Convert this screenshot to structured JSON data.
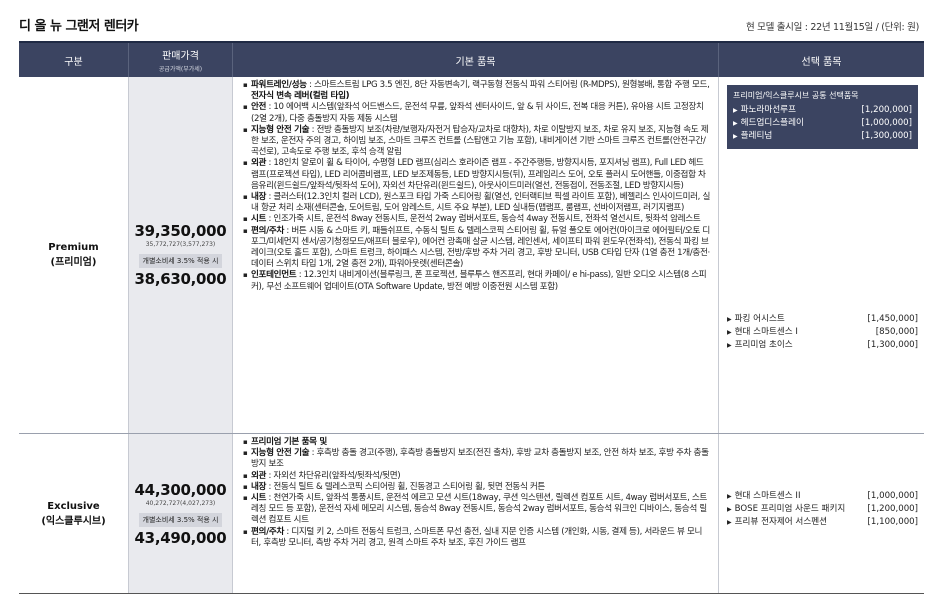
{
  "header": {
    "title": "디 올 뉴 그랜저 렌터카",
    "meta": "현 모델 출시일 : 22년 11월15일 / (단위: 원)"
  },
  "columns": {
    "gubun": "구분",
    "price": "판매가격",
    "price_sub": "공급가액(부가세)",
    "basic": "기본 품목",
    "option": "선택 품목"
  },
  "rows": [
    {
      "name": "Premium",
      "name_ko": "(프리미엄)",
      "price": "39,350,000",
      "price_detail": "35,772,727(3,577,273)",
      "badge": "개별소비세 3.5% 적용 시",
      "price_tax": "38,630,000",
      "basic": [
        "<b>파워트레인/성능</b> : 스마트스트림 LPG 3.5 엔진, 8단 자동변속기, 랙구동형 전동식 파워 스티어링 (R-MDPS), 원형봉배, 통합 주행 모드, <b>전자식 변속 레버(컬럼 타입)</b>",
        "<b>안전</b> : 10 에어백 시스템(앞좌석 어드밴스드, 운전석 무릎, 앞좌석 센터사이드, 앞 &amp; 뒤 사이드, 전복 대응 커튼), 유아용 시트 고정장치(2열 2개), 다중 충돌방지 자동 제동 시스템",
        "<b>지능형 안전 기술</b> : 전방 충돌방지 보조(차량/보행자/자전거 탑승자/교차로 대향차), 차로 이탈방지 보조, 차로 유지 보조, 지능형 속도 제한 보조, 운전자 주의 경고, 하이빔 보조, 스마트 크루즈 컨트롤 (스탑앤고 기능 포함), 내비게이션 기반 스마트 크루즈 컨트롤(안전구간/곡선로), 고속도로 주행 보조, 후석 승객 알림",
        "<b>외관</b> : 18인치 알로이 휠 &amp; 타이어, 수평형 LED 램프(심리스 호라이즌 램프 - 주간주행등, 방향지시등, 포지셔닝 램프), Full LED 헤드램프(프로젝션 타입), LED 리어콤비램프, LED 보조제동등, LED 방향지시등(뒤), 프레임리스 도어, 오토 플러시 도어핸들, 이중접합 차음유리(윈드쉴드/앞좌석/뒷좌석 도어), 자외선 차단유리(윈드쉴드), 아웃사이드미러(열선, 전동접이, 전동조절, LED 방향지시등)",
        "<b>내장</b> : 클러스터(12.3인치 컬러 LCD), 원스포크 타입 가죽 스티어링 휠(열선, 인터랙티브 픽셀 라이트 포함), 베젤리스 인사이드미러, 실내 항균 처리 소재(센터콘솔, 도어트림, 도어 암레스트, 시트 주요 부분), LED 실내등(맵램프, 룸램프, 선바이저램프, 러기지램프)",
        "<b>시트</b> : 인조가죽 시트, 운전석 8way 전동시트, 운전석 2way 럼버서포트, 동승석 4way 전동시트, 전좌석 열선시트, 뒷좌석 암레스트",
        "<b>편의/주차</b> : 버튼 시동 &amp; 스마트 키, 패들쉬프트, 수동식 틸트 &amp; 텔레스코픽 스티어링 휠, 듀얼 풀오토 에어컨(마이크로 에어필터/오토 디포그/미세먼지 센서/공기청정모드/애프터 블로우), 에어컨 광촉매 살균 시스템, 레인센서, 세이프티 파워 윈도우(전좌석), 전동식 파킹 브레이크(오토 홀드 포함), 스마트 트렁크, 하이패스 시스템, 전방/후방 주차 거리 경고, 후방 모니터, USB C타입 단자 (1열 충전 1개/충전·데이터 스위치 타입 1개, 2열 충전 2개), 파워아웃렛(센터콘솔)",
        "<b>인포테인먼트</b> : 12.3인치 내비게이션(블루링크, 폰 프로젝션, 블루투스 핸즈프리, 현대 카페이/ e hi-pass), 일반 오디오 시스템(8 스피커), 무선 소프트웨어 업데이트(OTA Software Update, 방전 예방 이중전원 시스템 포함)"
      ],
      "option_box_title": "프리미엄/익스클루시브 공통 선택품목",
      "option_box": [
        {
          "label": "파노라마선루프",
          "price": "[1,200,000]"
        },
        {
          "label": "헤드업디스플레이",
          "price": "[1,000,000]"
        },
        {
          "label": "플레티넘",
          "price": "[1,300,000]"
        }
      ],
      "options": [
        {
          "label": "파킹 어시스트",
          "price": "[1,450,000]"
        },
        {
          "label": "현대 스마트센스 I",
          "price": "[850,000]"
        },
        {
          "label": "프리미엄 초이스",
          "price": "[1,300,000]"
        }
      ]
    },
    {
      "name": "Exclusive",
      "name_ko": "(익스클루시브)",
      "price": "44,300,000",
      "price_detail": "40,272,727(4,027,273)",
      "badge": "개별소비세 3.5% 적용 시",
      "price_tax": "43,490,000",
      "basic": [
        "<b>프리미엄 기본 품목 및</b>",
        "<b>지능형 안전 기술</b> : 후측방 충돌 경고(주행), 후측방 충돌방지 보조(전진 출차), 후방 교차 충돌방지 보조, 안전 하차 보조, 후방 주차 충돌방지 보조",
        "<b>외관</b> : 자외선 차단유리(앞좌석/뒷좌석/뒷면)",
        "<b>내장</b> : 전동식 틸트 &amp; 텔레스코픽 스티어링 휠, 진동경고 스티어링 휠, 뒷면 전동식 커튼",
        "<b>시트</b> : 천연가죽 시트, 앞좌석 통풍시트, 운전석 에르고 모션 시트(18way, 쿠션 익스텐션, 릴렉션 컴포트 시트, 4way 럼버서포트, 스트레칭 모드 등 포함), 운전석 자세 메모리 시스템, 동승석 8way 전동시트, 동승석 2way 럼버서포트, 동승석 워크인 디바이스, 동승석 릴렉션 컴포트 시트",
        "<b>편의/주차</b> : 디지털 키 2, 스마트 전동식 트렁크, 스마트폰 무선 충전, 실내 지문 인증 시스템 (개인화, 시동, 결제 등), 서라운드 뷰 모니터, 후측방 모니터, 측방 주차 거리 경고, 원격 스마트 주차 보조, 후진 가이드 램프"
      ],
      "options": [
        {
          "label": "현대 스마트센스 II",
          "price": "[1,000,000]"
        },
        {
          "label": "BOSE 프리미엄 사운드 패키지",
          "price": "[1,200,000]"
        },
        {
          "label": "프리뷰 전자제어 서스펜션",
          "price": "[1,100,000]"
        }
      ]
    }
  ]
}
